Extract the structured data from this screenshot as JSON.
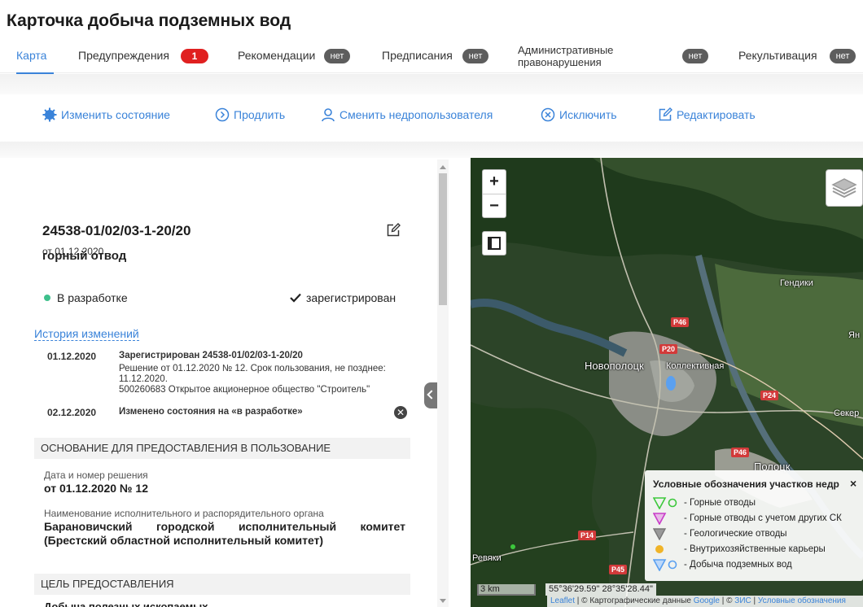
{
  "page": {
    "title": "Карточка добыча подземных вод"
  },
  "tabs": [
    {
      "label": "Карта",
      "active": true
    },
    {
      "label": "Предупреждения",
      "badge": "1"
    },
    {
      "label": "Рекомендации",
      "badge": "нет"
    },
    {
      "label": "Предписания",
      "badge": "нет"
    },
    {
      "label": "Административные правонарушения",
      "badge": "нет"
    },
    {
      "label": "Рекультивация",
      "badge": "нет"
    }
  ],
  "actions": {
    "change_state": "Изменить состояние",
    "extend": "Продлить",
    "change_user": "Сменить недропользователя",
    "exclude": "Исключить",
    "edit": "Редактировать"
  },
  "doc": {
    "number": "24538-01/02/03-1-20/20",
    "date": "от 01.12.2020",
    "type": "горный отвод",
    "state": "В разработке",
    "registration": "зарегистрирован"
  },
  "history": {
    "link": "История изменений",
    "entries": [
      {
        "date": "01.12.2020",
        "title": "Зарегистрирован 24538-01/02/03-1-20/20",
        "line1": "Решение от 01.12.2020 № 12. Срок пользования, не позднее:",
        "line2": "11.12.2020.",
        "line3": "500260683 Открытое акционерное общество \"Строитель\""
      },
      {
        "date": "02.12.2020",
        "title": "Изменено состояния на «в разработке»"
      }
    ]
  },
  "basis": {
    "header": "ОСНОВАНИЕ ДЛЯ ПРЕДОСТАВЛЕНИЯ В ПОЛЬЗОВАНИЕ",
    "decision_label": "Дата и номер решения",
    "decision_value": "от 01.12.2020 № 12",
    "organ_label": "Наименование исполнительного и распорядительного органа",
    "organ_words": [
      "Барановичский",
      "городской",
      "исполнительный",
      "комитет"
    ],
    "organ_line2": "(Брестский областной исполнительный комитет)"
  },
  "purpose": {
    "header": "ЦЕЛЬ ПРЕДОСТАВЛЕНИЯ",
    "value": "Добыча полезных ископаемых"
  },
  "map": {
    "zoom_in": "+",
    "zoom_out": "−",
    "places": {
      "novopolotsk": "Новополоцк",
      "kollektivnaya": "Коллективная",
      "gendiki": "Гендики",
      "polotsk": "Полоцк",
      "revyaki": "Ревяки",
      "seker": "Секер",
      "yan": "Ян"
    },
    "roads": [
      "P46",
      "P20",
      "P24",
      "P46",
      "P14",
      "P45"
    ],
    "scale": "3 km",
    "coords": "55°36'29.59\" 28°35'28.44\"",
    "attribution": {
      "leaflet": "Leaflet",
      "text": " | © Картографические данные ",
      "google": "Google",
      "sep": " | © ",
      "zis": "ЗИС",
      "sep2": " | ",
      "legend_link": "Условные обозначения"
    },
    "legend": {
      "title": "Условные обозначения участков недр",
      "close": "×",
      "items": [
        {
          "label": "- Горные отводы",
          "color": "#3cc83c"
        },
        {
          "label": "- Горные отводы с учетом других СК",
          "color": "#c83cc8"
        },
        {
          "label": "- Геологические отводы",
          "color": "#999999"
        },
        {
          "label": "- Внутрихозяйственные карьеры",
          "color": "#f0b428"
        },
        {
          "label": "- Добыча подземных вод",
          "color": "#5aa0f0"
        }
      ]
    }
  },
  "colors": {
    "accent": "#3a83d9",
    "badge_red": "#e02020",
    "badge_dark": "#5d5d5d",
    "state_dot": "#3ec08c"
  }
}
